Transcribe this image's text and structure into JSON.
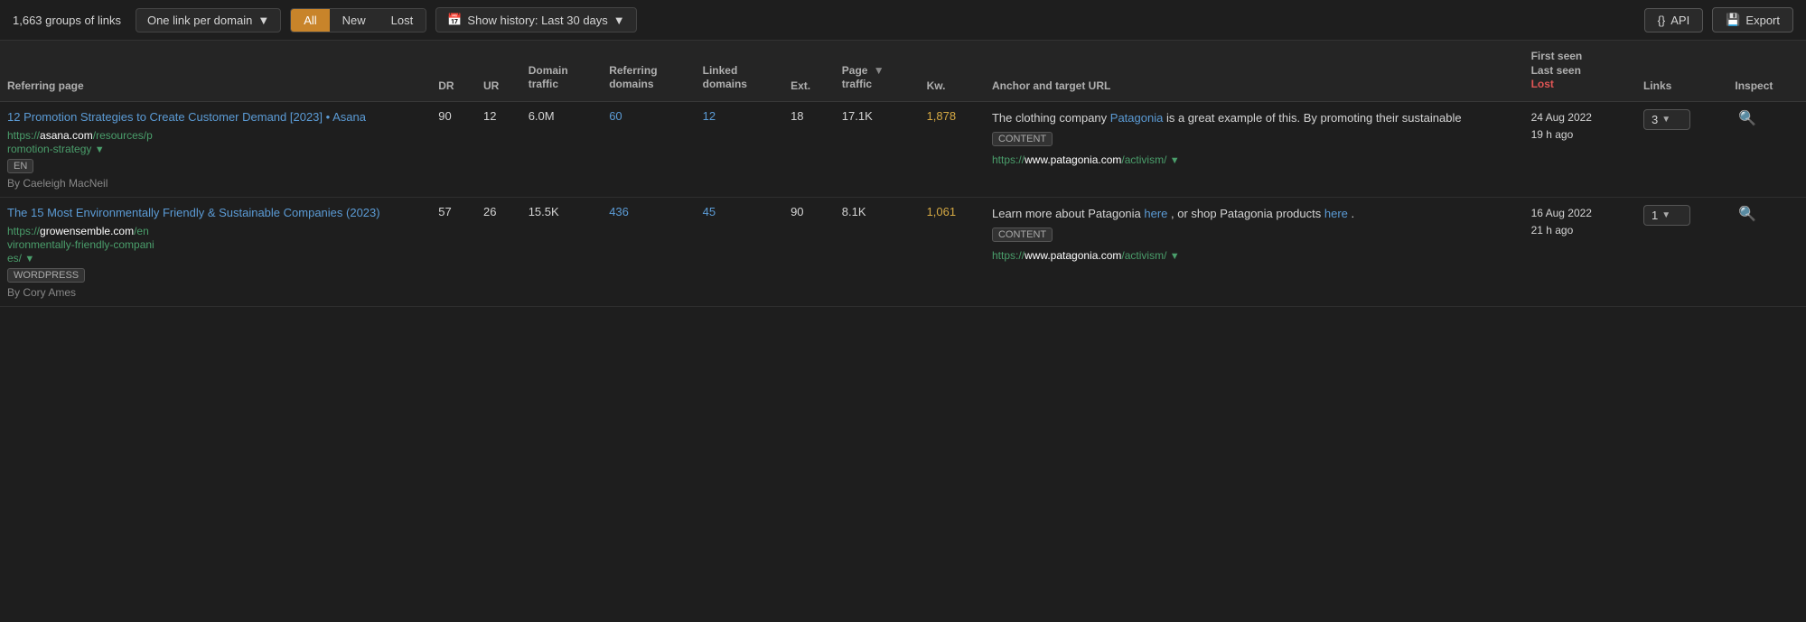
{
  "toolbar": {
    "groups_count": "1,663 groups of links",
    "domain_filter_label": "One link per domain",
    "filters": [
      "All",
      "New",
      "Lost"
    ],
    "active_filter": "All",
    "history_label": "Show history: Last 30 days",
    "api_label": "API",
    "export_label": "Export"
  },
  "table": {
    "headers": [
      {
        "key": "referring_page",
        "label": "Referring page"
      },
      {
        "key": "dr",
        "label": "DR"
      },
      {
        "key": "ur",
        "label": "UR"
      },
      {
        "key": "domain_traffic",
        "label": "Domain\ntraffic"
      },
      {
        "key": "referring_domains",
        "label": "Referring\ndomains"
      },
      {
        "key": "linked_domains",
        "label": "Linked\ndomains"
      },
      {
        "key": "ext",
        "label": "Ext."
      },
      {
        "key": "page_traffic",
        "label": "Page\ntraffic",
        "sorted": true
      },
      {
        "key": "kw",
        "label": "Kw."
      },
      {
        "key": "anchor_target",
        "label": "Anchor and target URL"
      },
      {
        "key": "first_last_seen",
        "label": "First seen\nLast seen\nLost"
      },
      {
        "key": "links",
        "label": "Links"
      },
      {
        "key": "inspect",
        "label": "Inspect"
      }
    ],
    "rows": [
      {
        "title": "12 Promotion Strategies to Create Customer Demand [2023] • Asana",
        "url_prefix": "https://",
        "url_domain": "asana.com",
        "url_path": "/resources/p\nromotion-strategy",
        "url_full": "https://asana.com/resources/p\nromotion-strategy",
        "badge": "EN",
        "author": "By Caeleigh MacNeil",
        "dr": "90",
        "ur": "12",
        "domain_traffic": "6.0M",
        "referring_domains": "60",
        "linked_domains": "12",
        "ext": "18",
        "page_traffic": "17.1K",
        "kw": "1,878",
        "anchor_text_before": "The clothing company ",
        "anchor_link_text": "Patagonia",
        "anchor_text_after": " is a great example of this. By promoting their sustainable",
        "content_badge": "CONTENT",
        "anchor_url_prefix": "https://",
        "anchor_url_domain": "www.patagonia.com",
        "anchor_url_path": "/activism/",
        "first_seen": "24 Aug 2022",
        "last_seen": "19 h ago",
        "links_count": "3",
        "lost": false
      },
      {
        "title": "The 15 Most Environmentally Friendly & Sustainable Companies (2023)",
        "url_prefix": "https://",
        "url_domain": "growensemble.com",
        "url_path": "/en\nvironmentally-friendly-compani\nes/",
        "url_full": "https://growensemble.com/en\nvironmentally-friendly-compani\nes/",
        "badge": "WORDPRESS",
        "author": "By Cory Ames",
        "dr": "57",
        "ur": "26",
        "domain_traffic": "15.5K",
        "referring_domains": "436",
        "linked_domains": "45",
        "ext": "90",
        "page_traffic": "8.1K",
        "kw": "1,061",
        "anchor_text_before": "Learn more about Patagonia ",
        "anchor_link_text": "here",
        "anchor_text_middle": " , or shop\nPatagonia products ",
        "anchor_link_text2": "here",
        "anchor_text_after": " .",
        "content_badge": "CONTENT",
        "anchor_url_prefix": "https://",
        "anchor_url_domain": "www.patagonia.com",
        "anchor_url_path": "/activism/",
        "first_seen": "16 Aug 2022",
        "last_seen": "21 h ago",
        "links_count": "1",
        "lost": false
      }
    ]
  }
}
